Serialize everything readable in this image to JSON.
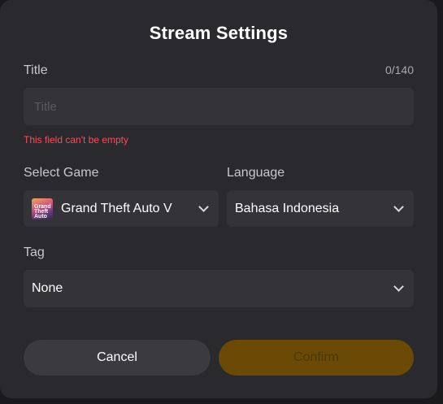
{
  "modal": {
    "title": "Stream Settings",
    "title_field": {
      "label": "Title",
      "counter": "0/140",
      "value": "",
      "placeholder": "Title",
      "error": "This field can't be empty"
    },
    "game_field": {
      "label": "Select Game",
      "value": "Grand Theft Auto V",
      "thumb_text": "Grand Theft Auto"
    },
    "language_field": {
      "label": "Language",
      "value": "Bahasa Indonesia"
    },
    "tag_field": {
      "label": "Tag",
      "value": "None"
    },
    "buttons": {
      "cancel": "Cancel",
      "confirm": "Confirm"
    },
    "colors": {
      "background": "#2a2a2e",
      "field": "#333338",
      "error": "#ff4b55",
      "confirm_disabled": "#6b4a06"
    }
  }
}
